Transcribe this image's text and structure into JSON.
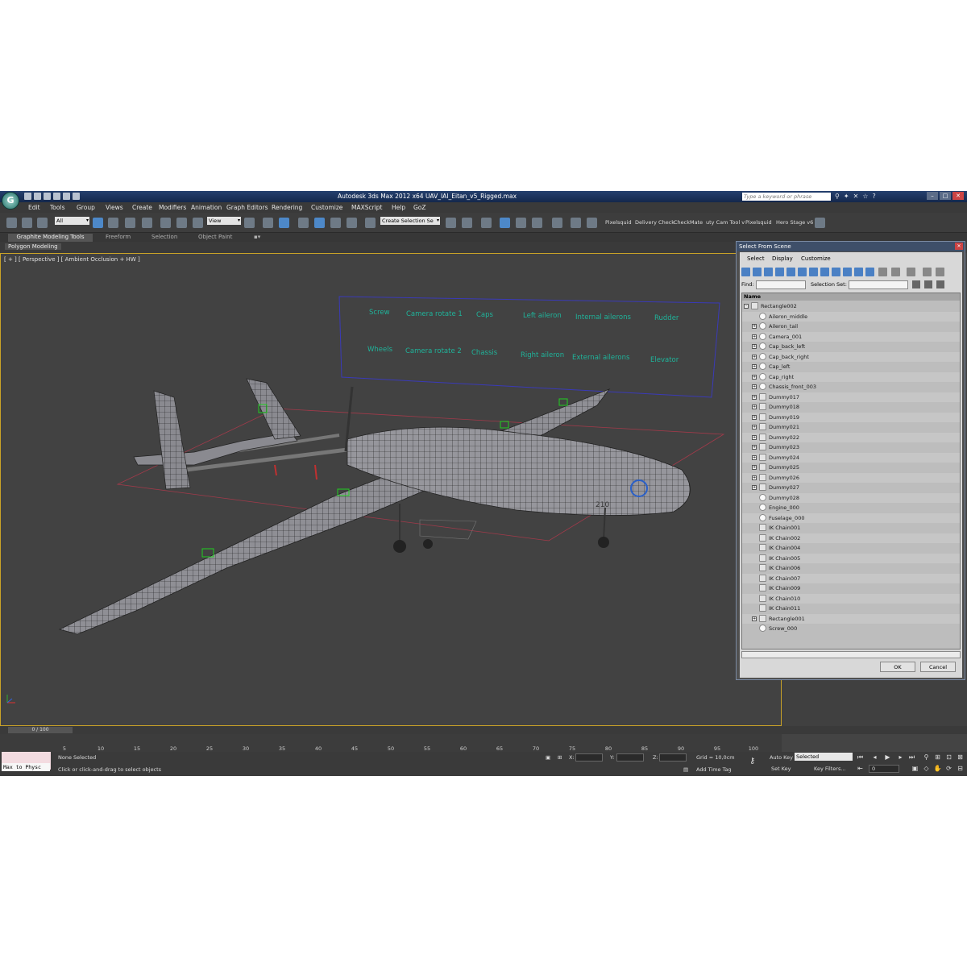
{
  "app": {
    "title": "Autodesk 3ds Max  2012 x64     UAV_IAI_Eitan_v5_Rigged.max",
    "logo": "G",
    "search_placeholder": "Type a keyword or phrase"
  },
  "menu": [
    "Edit",
    "Tools",
    "Group",
    "Views",
    "Create",
    "Modifiers",
    "Animation",
    "Graph Editors",
    "Rendering",
    "Customize",
    "MAXScript",
    "Help",
    "GoZ"
  ],
  "toolbar": {
    "selection_filter": "All",
    "ref_coord": "View",
    "named_selection": "Create Selection Se",
    "plugins": [
      "Pixelsquid",
      "Delivery Check",
      "CheckMate",
      "uty Cam Tool v",
      "Pixelsquid",
      "Hero Stage v6"
    ]
  },
  "ribbon": {
    "tabs": [
      "Graphite Modeling Tools",
      "Freeform",
      "Selection",
      "Object Paint"
    ],
    "sub": "Polygon Modeling"
  },
  "viewport": {
    "label": "[ + ] [ Perspective ] [ Ambient Occlusion + HW ]",
    "controls_top": [
      "Screw",
      "Camera rotate 1",
      "Caps",
      "Left aileron",
      "Internal ailerons",
      "Rudder"
    ],
    "controls_bottom": [
      "Wheels",
      "Camera rotate 2",
      "Chassis",
      "Right aileron",
      "External ailerons",
      "Elevator"
    ],
    "fuselage_marking": "210",
    "wire_color": "#1c1c1c",
    "control_color": "#1fb39a"
  },
  "dialog": {
    "title": "Select From Scene",
    "menu": [
      "Select",
      "Display",
      "Customize"
    ],
    "find_label": "Find:",
    "selection_set_label": "Selection Set:",
    "column_name": "Name",
    "items": [
      {
        "name": "Rectangle002",
        "exp": "-",
        "icon": "shape",
        "indent": 0
      },
      {
        "name": "Aileron_middle",
        "exp": "",
        "icon": "sphere",
        "indent": 1
      },
      {
        "name": "Aileron_tail",
        "exp": "+",
        "icon": "sphere",
        "indent": 1
      },
      {
        "name": "Camera_001",
        "exp": "+",
        "icon": "sphere",
        "indent": 1
      },
      {
        "name": "Cap_back_left",
        "exp": "+",
        "icon": "sphere",
        "indent": 1
      },
      {
        "name": "Cap_back_right",
        "exp": "+",
        "icon": "sphere",
        "indent": 1
      },
      {
        "name": "Cap_left",
        "exp": "+",
        "icon": "sphere",
        "indent": 1
      },
      {
        "name": "Cap_right",
        "exp": "+",
        "icon": "sphere",
        "indent": 1
      },
      {
        "name": "Chassis_front_003",
        "exp": "+",
        "icon": "sphere",
        "indent": 1
      },
      {
        "name": "Dummy017",
        "exp": "+",
        "icon": "bone",
        "indent": 1
      },
      {
        "name": "Dummy018",
        "exp": "+",
        "icon": "bone",
        "indent": 1
      },
      {
        "name": "Dummy019",
        "exp": "+",
        "icon": "bone",
        "indent": 1
      },
      {
        "name": "Dummy021",
        "exp": "+",
        "icon": "bone",
        "indent": 1
      },
      {
        "name": "Dummy022",
        "exp": "+",
        "icon": "bone",
        "indent": 1
      },
      {
        "name": "Dummy023",
        "exp": "+",
        "icon": "bone",
        "indent": 1
      },
      {
        "name": "Dummy024",
        "exp": "+",
        "icon": "bone",
        "indent": 1
      },
      {
        "name": "Dummy025",
        "exp": "+",
        "icon": "bone",
        "indent": 1
      },
      {
        "name": "Dummy026",
        "exp": "+",
        "icon": "bone",
        "indent": 1
      },
      {
        "name": "Dummy027",
        "exp": "+",
        "icon": "bone",
        "indent": 1
      },
      {
        "name": "Dummy028",
        "exp": "",
        "icon": "sphere",
        "indent": 1
      },
      {
        "name": "Engine_000",
        "exp": "",
        "icon": "sphere",
        "indent": 1
      },
      {
        "name": "Fuselage_000",
        "exp": "",
        "icon": "sphere",
        "indent": 1
      },
      {
        "name": "IK Chain001",
        "exp": "",
        "icon": "bone",
        "indent": 1
      },
      {
        "name": "IK Chain002",
        "exp": "",
        "icon": "bone",
        "indent": 1
      },
      {
        "name": "IK Chain004",
        "exp": "",
        "icon": "bone",
        "indent": 1
      },
      {
        "name": "IK Chain005",
        "exp": "",
        "icon": "bone",
        "indent": 1
      },
      {
        "name": "IK Chain006",
        "exp": "",
        "icon": "bone",
        "indent": 1
      },
      {
        "name": "IK Chain007",
        "exp": "",
        "icon": "bone",
        "indent": 1
      },
      {
        "name": "IK Chain009",
        "exp": "",
        "icon": "bone",
        "indent": 1
      },
      {
        "name": "IK Chain010",
        "exp": "",
        "icon": "bone",
        "indent": 1
      },
      {
        "name": "IK Chain011",
        "exp": "",
        "icon": "bone",
        "indent": 1
      },
      {
        "name": "Rectangle001",
        "exp": "+",
        "icon": "shape",
        "indent": 1
      },
      {
        "name": "Screw_000",
        "exp": "",
        "icon": "sphere",
        "indent": 1
      }
    ],
    "ok": "OK",
    "cancel": "Cancel"
  },
  "timeline": {
    "slider": "0 / 100",
    "ticks": [
      "5",
      "10",
      "15",
      "20",
      "25",
      "30",
      "35",
      "40",
      "45",
      "50",
      "55",
      "60",
      "65",
      "70",
      "75",
      "80",
      "85",
      "90",
      "95",
      "100"
    ]
  },
  "status": {
    "maxscript": "Max to Physc",
    "selection": "None Selected",
    "prompt": "Click or click-and-drag to select objects",
    "x_label": "X:",
    "y_label": "Y:",
    "z_label": "Z:",
    "grid": "Grid = 10,0cm",
    "add_time_tag": "Add Time Tag",
    "auto_key": "Auto Key",
    "selected": "Selected",
    "set_key": "Set Key",
    "key_filters": "Key Filters...",
    "frame": "0"
  }
}
